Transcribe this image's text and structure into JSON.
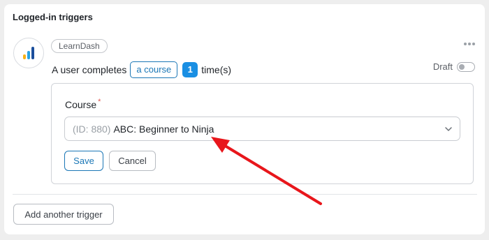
{
  "panel": {
    "title": "Logged-in triggers"
  },
  "trigger": {
    "integration_name": "LearnDash",
    "integration_icon": "learndash-bars-icon",
    "sentence_prefix": "A user completes",
    "course_token": "a course",
    "times_token": "1",
    "sentence_suffix": "time(s)",
    "status_label": "Draft",
    "status_on": false
  },
  "form": {
    "course_label": "Course",
    "required_marker": "*",
    "select_id_prefix": "(ID: 880)",
    "select_value": "ABC: Beginner to Ninja",
    "save_label": "Save",
    "cancel_label": "Cancel"
  },
  "footer": {
    "add_trigger_label": "Add another trigger"
  },
  "colors": {
    "accent": "#1b77b6",
    "number_badge": "#1a8fe3",
    "annotation_arrow": "#e8161b",
    "required": "#e0574f"
  }
}
